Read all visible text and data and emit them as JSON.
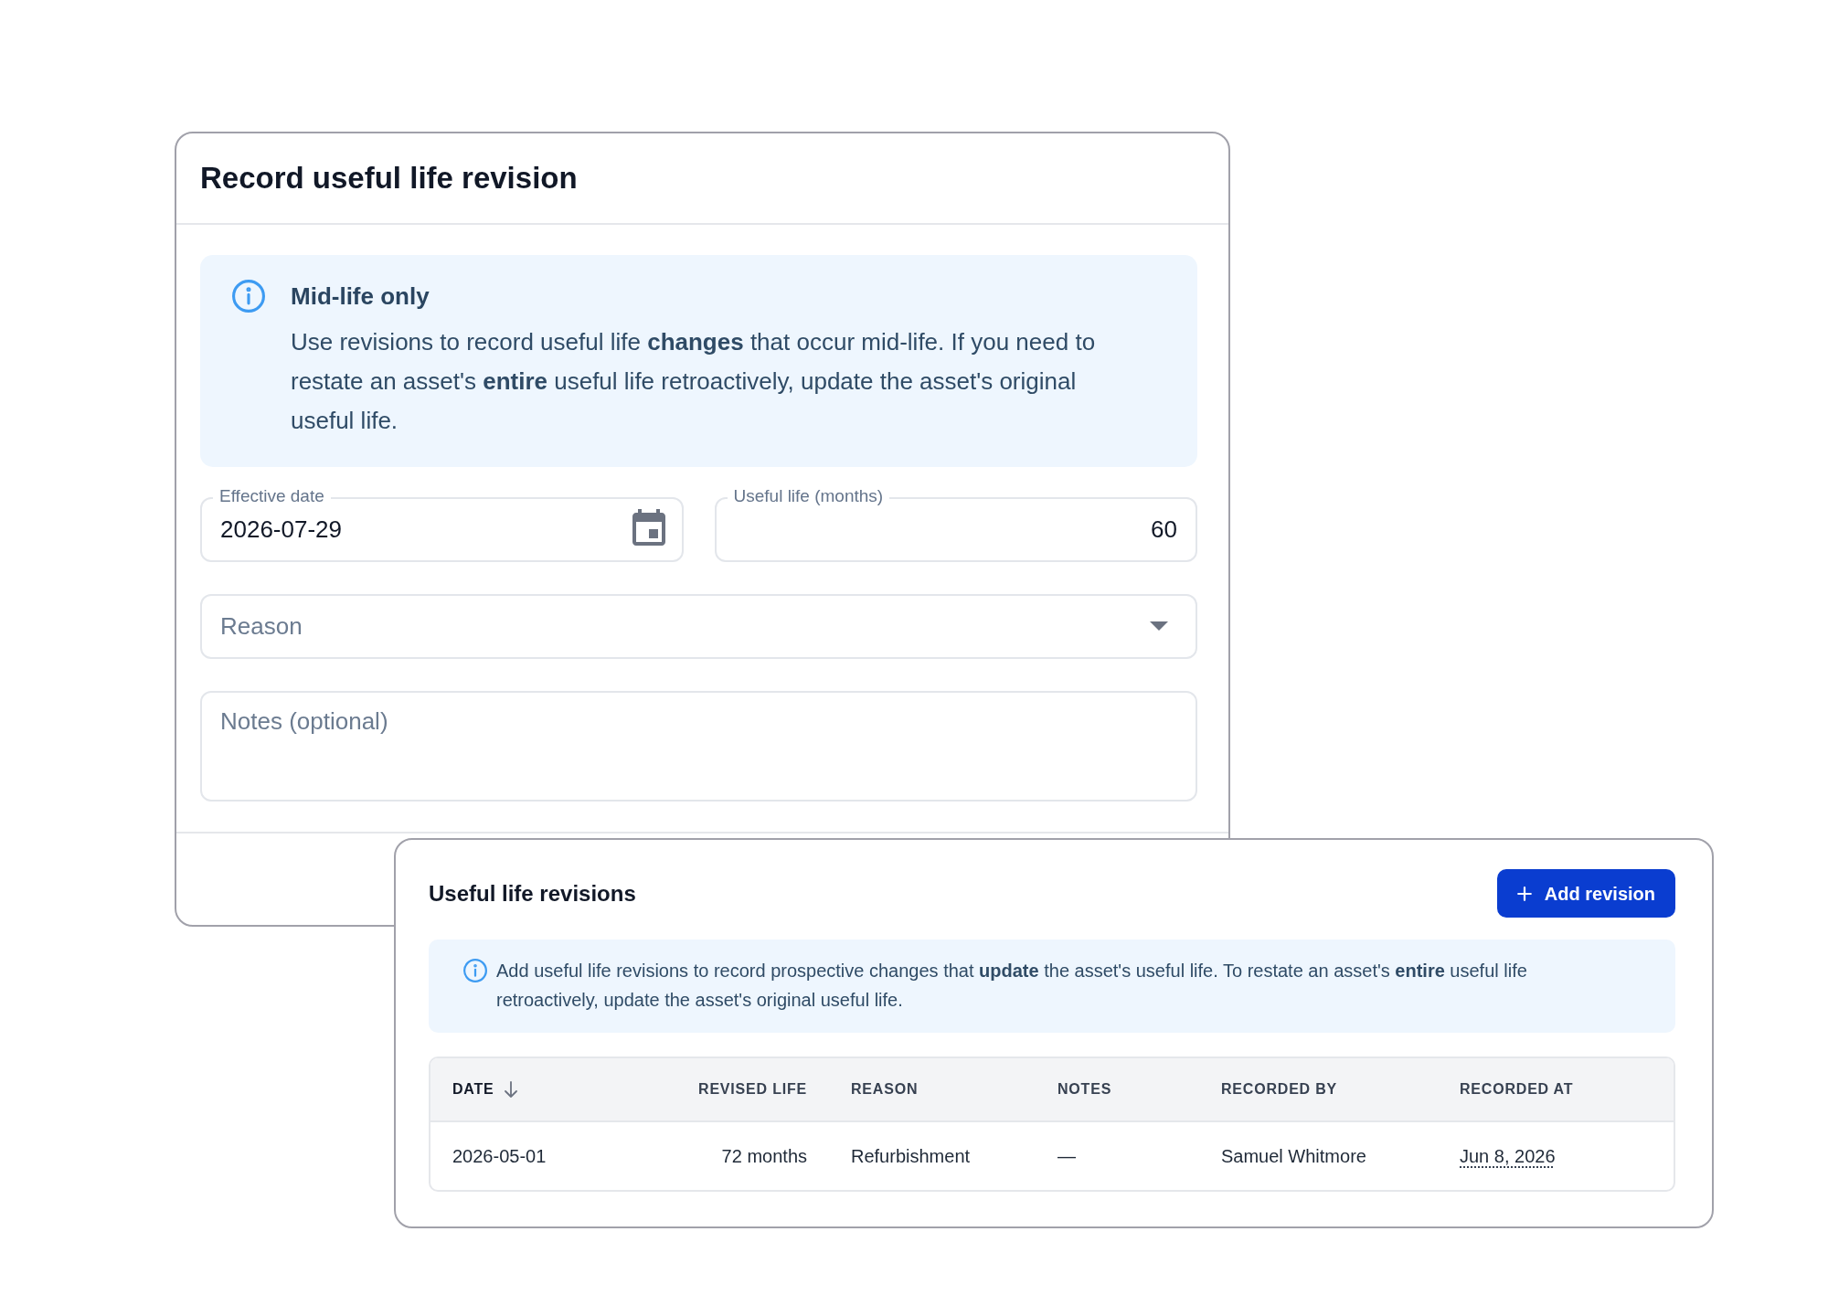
{
  "record_dialog": {
    "title": "Record useful life revision",
    "notice": {
      "title": "Mid-life only",
      "text": "Use revisions to record useful life **changes** that occur mid-life. If you need to restate an asset's **entire** useful life retroactively, update the asset's original useful life."
    },
    "fields": [
      {
        "kind": "date",
        "label": "Effective date",
        "value": "2026-07-29"
      },
      {
        "kind": "number",
        "label": "Useful life (months)",
        "value": "60"
      },
      {
        "kind": "select",
        "placeholder": "Reason"
      },
      {
        "kind": "textarea",
        "placeholder": "Notes (optional)"
      }
    ]
  },
  "revisions_card": {
    "title": "Useful life revisions",
    "add_button": {
      "label": "Add revision"
    },
    "notice": {
      "text": "Add useful life revisions to record prospective changes that **update** the asset's useful life. To restate an asset's **entire** useful life retroactively, update the asset's original useful life."
    },
    "table": {
      "columns": [
        {
          "label": "DATE",
          "sorted": true
        },
        {
          "label": "REVISED LIFE",
          "sorted": false
        },
        {
          "label": "REASON",
          "sorted": false
        },
        {
          "label": "NOTES",
          "sorted": false
        },
        {
          "label": "RECORDED BY",
          "sorted": false
        },
        {
          "label": "RECORDED AT",
          "sorted": false
        }
      ],
      "rows": [
        {
          "cells": [
            "2026-05-01",
            "72 months",
            "Refurbishment",
            "—",
            "Samuel Whitmore",
            "Jun 8, 2026"
          ]
        }
      ]
    }
  }
}
